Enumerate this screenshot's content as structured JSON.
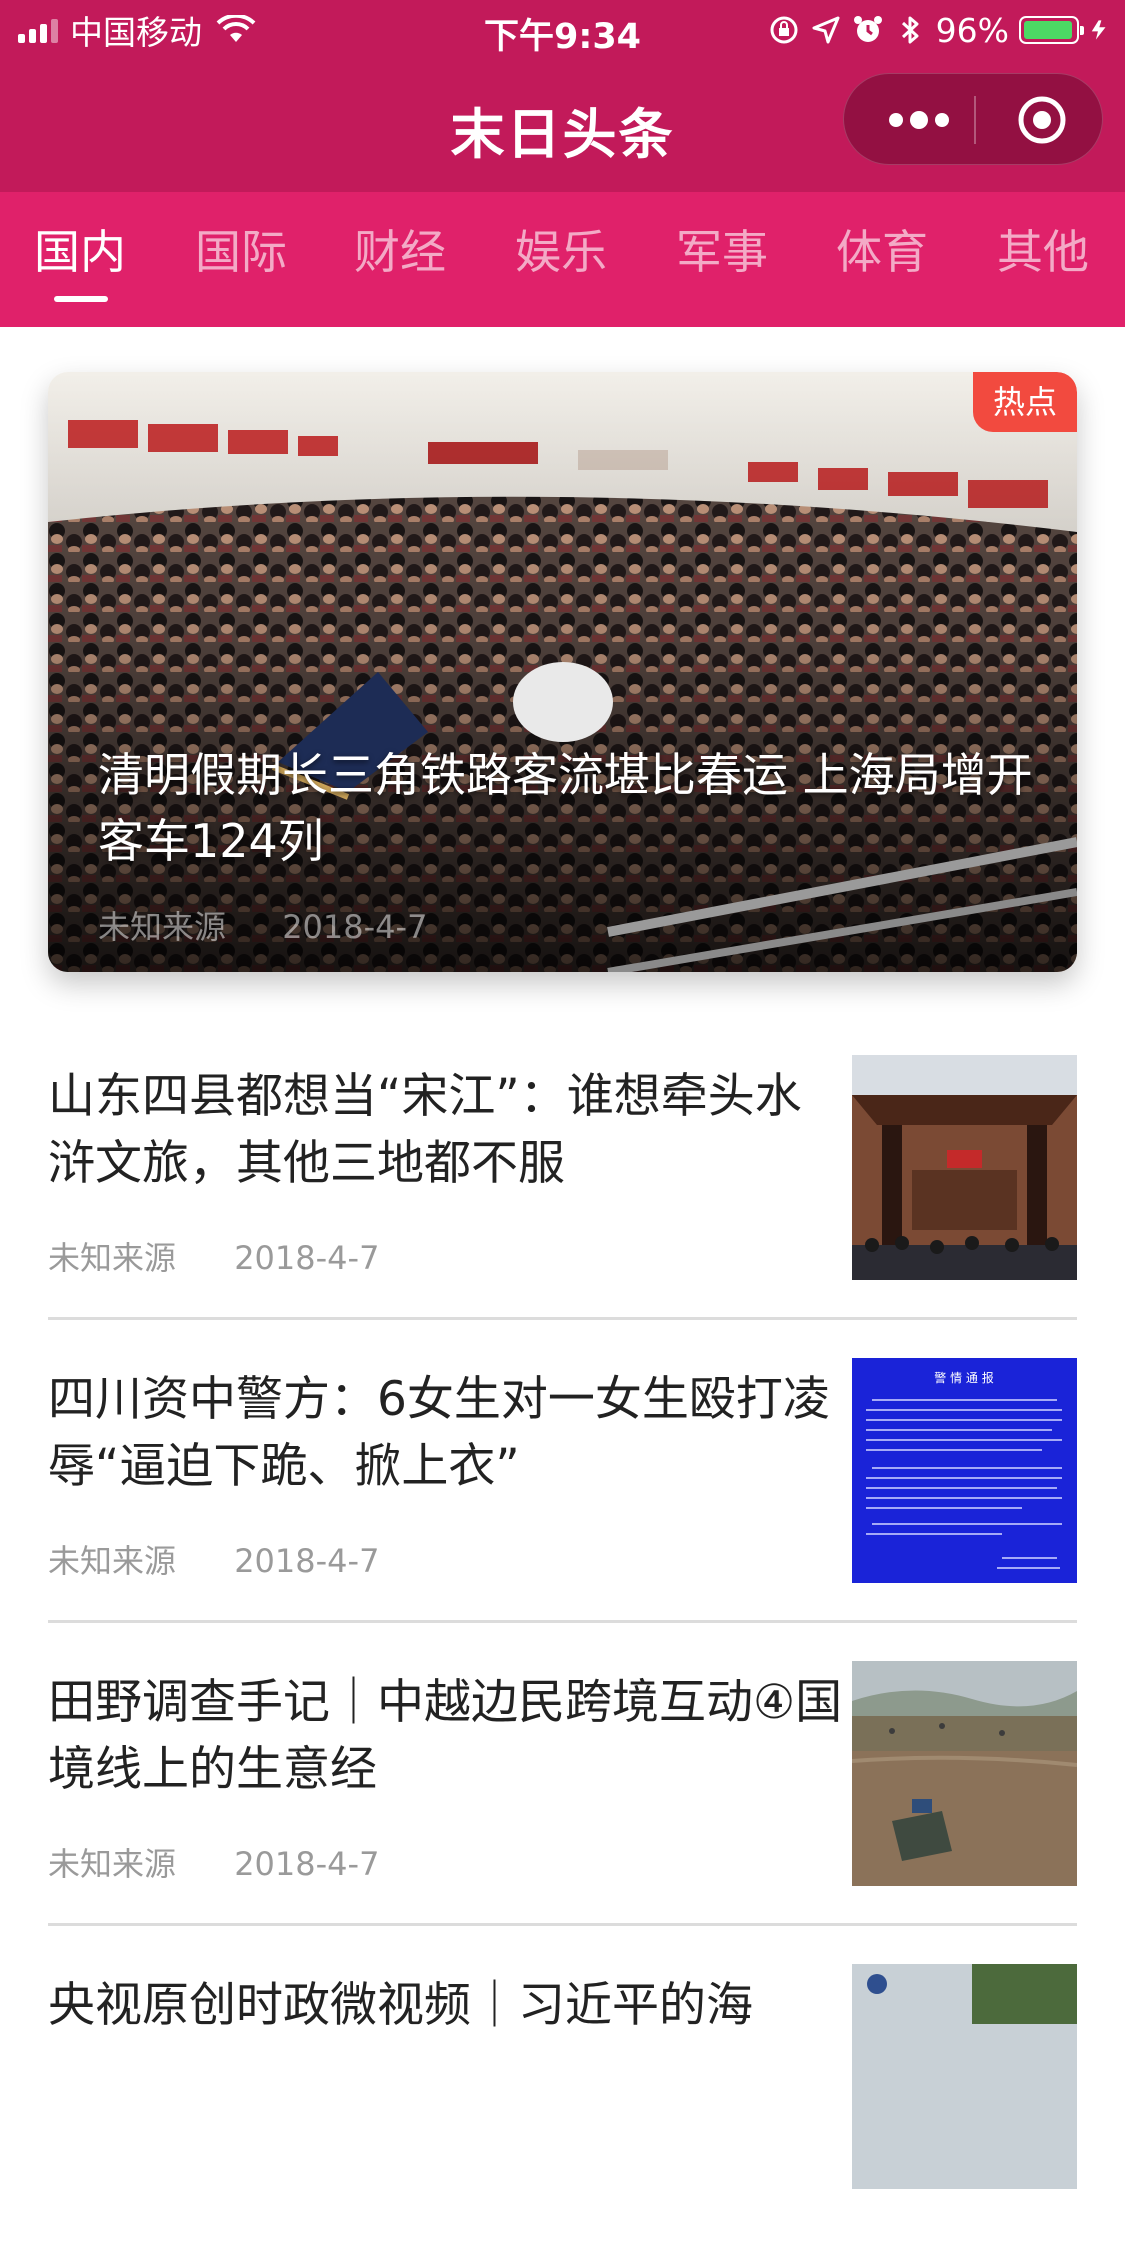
{
  "status_bar": {
    "carrier": "中国移动",
    "time": "下午9:34",
    "battery": "96%"
  },
  "nav": {
    "title": "末日头条"
  },
  "tabs": [
    {
      "label": "国内",
      "active": true
    },
    {
      "label": "国际",
      "active": false
    },
    {
      "label": "财经",
      "active": false
    },
    {
      "label": "娱乐",
      "active": false
    },
    {
      "label": "军事",
      "active": false
    },
    {
      "label": "体育",
      "active": false
    },
    {
      "label": "其他",
      "active": false
    }
  ],
  "hero": {
    "badge": "热点",
    "title": "清明假期长三角铁路客流堪比春运 上海局增开客车124列",
    "source": "未知来源",
    "date": "2018-4-7"
  },
  "news": [
    {
      "title": "山东四县都想当“宋江”：谁想牵头水浒文旅，其他三地都不服",
      "source": "未知来源",
      "date": "2018-4-7"
    },
    {
      "title": "四川资中警方：6女生对一女生殴打凌辱“逼迫下跪、掀上衣”",
      "source": "未知来源",
      "date": "2018-4-7"
    },
    {
      "title": "田野调查手记｜中越边民跨境互动④国境线上的生意经",
      "source": "未知来源",
      "date": "2018-4-7"
    },
    {
      "title": "央视原创时政微视频｜习近平的海",
      "source": "",
      "date": ""
    }
  ],
  "thumbs": {
    "police_notice_heading": "警 情 通 报"
  },
  "colors": {
    "nav_bg": "#c21a5a",
    "tabs_bg": "#e0216a",
    "hot_badge": "#f24a3f"
  }
}
